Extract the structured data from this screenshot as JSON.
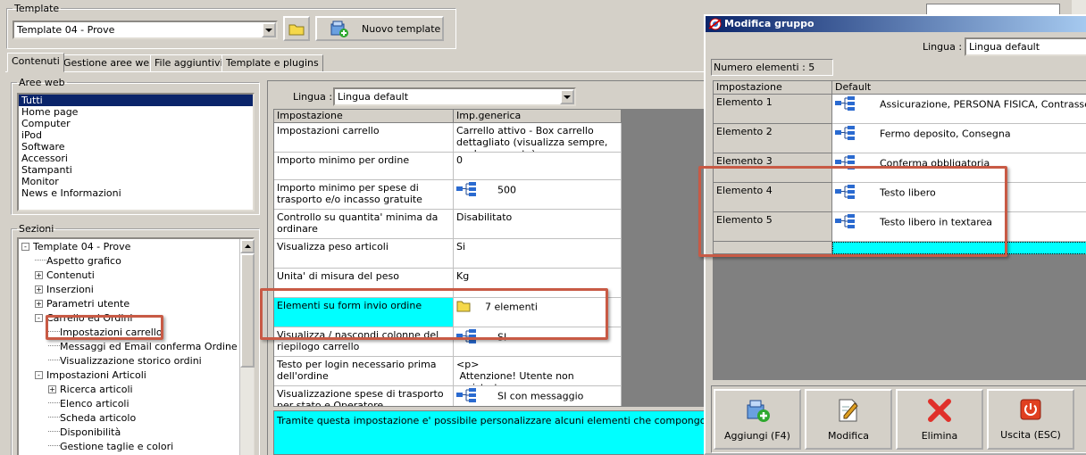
{
  "template_group": {
    "legend": "Template",
    "combo_value": "Template 04 - Prove",
    "new_template_label": "Nuovo template"
  },
  "tabs": [
    "Contenuti",
    "Gestione aree web",
    "File aggiuntivi",
    "Template e plugins"
  ],
  "aree_web": {
    "legend": "Aree web",
    "items": [
      "Tutti",
      "Home page",
      "Computer",
      "iPod",
      "Software",
      "Accessori",
      "Stampanti",
      "Monitor",
      "News e Informazioni"
    ]
  },
  "sezioni": {
    "legend": "Sezioni",
    "nodes": [
      {
        "label": "Template 04 - Prove",
        "indent": 0,
        "toggle": "-"
      },
      {
        "label": "Aspetto grafico",
        "indent": 1,
        "toggle": ""
      },
      {
        "label": "Contenuti",
        "indent": 1,
        "toggle": "+"
      },
      {
        "label": "Inserzioni",
        "indent": 1,
        "toggle": "+"
      },
      {
        "label": "Parametri utente",
        "indent": 1,
        "toggle": "+"
      },
      {
        "label": "Carrello ed Ordini",
        "indent": 1,
        "toggle": "-"
      },
      {
        "label": "Impostazioni carrello",
        "indent": 2,
        "toggle": ""
      },
      {
        "label": "Messaggi ed Email conferma Ordine",
        "indent": 2,
        "toggle": ""
      },
      {
        "label": "Visualizzazione storico ordini",
        "indent": 2,
        "toggle": ""
      },
      {
        "label": "Impostazioni Articoli",
        "indent": 1,
        "toggle": "-"
      },
      {
        "label": "Ricerca articoli",
        "indent": 2,
        "toggle": "+"
      },
      {
        "label": "Elenco articoli",
        "indent": 2,
        "toggle": ""
      },
      {
        "label": "Scheda articolo",
        "indent": 2,
        "toggle": ""
      },
      {
        "label": "Disponibilità",
        "indent": 2,
        "toggle": ""
      },
      {
        "label": "Gestione taglie e colori",
        "indent": 2,
        "toggle": ""
      }
    ]
  },
  "settings": {
    "lingua_label": "Lingua :",
    "lingua_value": "Lingua default",
    "col_impostazione": "Impostazione",
    "col_value": "Imp.generica",
    "rows": [
      {
        "name": "Impostazioni carrello",
        "value": "Carrello attivo - Box carrello dettagliato (visualizza sempre, anche se vuoto)",
        "icon": ""
      },
      {
        "name": "Importo minimo per ordine",
        "value": "0",
        "icon": ""
      },
      {
        "name": "Importo minimo per spese di trasporto e/o incasso gratuite",
        "value": "500",
        "icon": "tree"
      },
      {
        "name": "Controllo su quantita' minima da ordinare",
        "value": "Disabilitato",
        "icon": ""
      },
      {
        "name": "Visualizza peso articoli",
        "value": "Si",
        "icon": ""
      },
      {
        "name": "Unita' di misura del peso",
        "value": "Kg",
        "icon": ""
      },
      {
        "name": "Elementi su form invio ordine",
        "value": "7 elementi",
        "icon": "folder"
      },
      {
        "name": "Visualizza / nascondi colonne del riepilogo carrello",
        "value": "SI",
        "icon": "tree"
      },
      {
        "name": "Testo per login necessario prima dell'ordine",
        "value": "<p>\n Attenzione! Utente non registrato.",
        "icon": ""
      },
      {
        "name": "Visualizzazione spese di trasporto per stato e Operatore",
        "value": "SI con messaggio",
        "icon": "tree"
      }
    ],
    "description": "Tramite questa impostazione e' possibile personalizzare alcuni elementi che compongono il form di invio ordine"
  },
  "dialog": {
    "title": "Modifica gruppo",
    "lingua_label": "Lingua :",
    "lingua_value": "Lingua default",
    "count_label": "Numero elementi : 5",
    "col_impostazione": "Impostazione",
    "col_default": "Default",
    "rows": [
      {
        "name": "Elemento 1",
        "value": "Assicurazione, PERSONA FISICA, Contrassegno"
      },
      {
        "name": "Elemento 2",
        "value": "Fermo deposito, Consegna"
      },
      {
        "name": "Elemento 3",
        "value": "Conferma obbligatoria"
      },
      {
        "name": "Elemento 4",
        "value": "Testo libero"
      },
      {
        "name": "Elemento 5",
        "value": "Testo libero in textarea"
      }
    ],
    "buttons": {
      "add": "Aggiungi (F4)",
      "edit": "Modifica",
      "delete": "Elimina",
      "exit": "Uscita (ESC)"
    }
  },
  "colors": {
    "highlight_cyan": "#00ffff",
    "selection_blue": "#0a246a",
    "annotation_red": "#c85a45"
  }
}
